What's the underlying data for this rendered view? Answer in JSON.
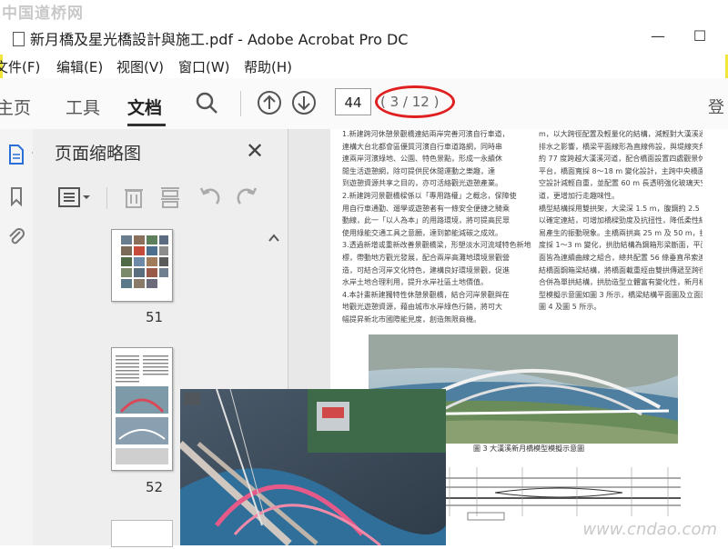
{
  "watermark_top": "中国道桥网",
  "window": {
    "title": "新月橋及星光橋設計與施工.pdf - Adobe Acrobat Pro DC"
  },
  "menu": [
    "文件(F)",
    "编辑(E)",
    "视图(V)",
    "窗口(W)",
    "帮助(H)"
  ],
  "tabs": {
    "home": "主页",
    "tools": "工具",
    "document": "文档"
  },
  "navigation": {
    "current_page": "44",
    "page_count": "( 3 / 12 )",
    "cut_label": "登"
  },
  "thumbnail_panel": {
    "title": "页面缩略图",
    "pages": [
      {
        "label": "51"
      },
      {
        "label": "52"
      }
    ]
  },
  "document_text": {
    "left_col": [
      "1.新建跨河休憩景觀橋連結兩岸完善河濱自行車道，",
      "連構大台北都會區優質河濱自行車道路網，同時串",
      "連兩岸河濱綠地、公園、特色景點，形成一永續休",
      "閒生活遊憩網，除可提供民休閒運動之樂趣，達",
      "到遊憩資源共享之目的，亦可活絡觀光遊憩產業。",
      "2.新建跨河景觀橋樑係以「專用路權」之概念，保障使",
      "用自行車通勤、遛學或遊憩者有一條安全便捷之騎乘",
      "動線，此一「以人為本」的用路環境，將可提高民眾",
      "使用綠能交通工具之意願，達到節能減碳之成效。",
      "3.透過新增或重新改善景觀橋梁，形塑淡水河流域特色新地",
      "標，帶動地方觀光發展，配合兩岸高灘地環境景觀營",
      "造，可結合河岸文化特色，建構良好環境景觀，促進",
      "水岸土地合理利用，提升水岸社區土地價值。",
      "4.本計畫新建獨特性休憩景觀橋，結合河岸景觀與在",
      "地觀光遊憩資源，藉由城市水岸綠色行銷，將可大",
      "幅提昇新北市國際能見度，創造無限商機。"
    ],
    "right_col": [
      "m，以大跨徑配置及輕量化的結構，減輕對大漢溪通洪",
      "排水之影響，橋梁平面線形為直線佈設，與堤線夾角",
      "約 77 度跨越大漢溪河道，配合橋面設置四處觀景休憩",
      "平台，橋面寬採 8～18 m 變化設計，主跨中央橋面拓寬",
      "空設計減輕自重，並配置 60 m 長透明強化玻璃天空步",
      "道，更增加行走趣味性。",
      "橋型結構採用雙拱架，大梁深 1.5 m，腹鋼約 2.5 m",
      "以確定連結，可增加橋樑勁度及抗扭性，降低柔性結構",
      "易產生的振動現象。主橋兩拱高 25 m 及 50 m，拱肋深",
      "度採 1～3 m 變化，拱肋結構為鋼箱形梁斷面，平面立",
      "面皆為連續曲線之組合，總共配置 56 條垂直吊索連",
      "結橋面鋼箱梁結構，將橋面載重經由雙拱傳遞至跨徑中央",
      "合併為單拱結構，拱肋造型立體富有變化性，新月橋整",
      "型模擬示意圖如圖 3 所示，橋梁結構平面圖及立面圖如",
      "圖 4 及圖 5 所示。"
    ],
    "figure_caption": "圖 3  大漢溪新月橋模型模擬示意圖"
  },
  "watermark_bottom": "www.cndao.com",
  "colors": {
    "accent_red": "#e02020",
    "frame_yellow": "#f2e63a",
    "water_blue": "#3a7fc0"
  }
}
